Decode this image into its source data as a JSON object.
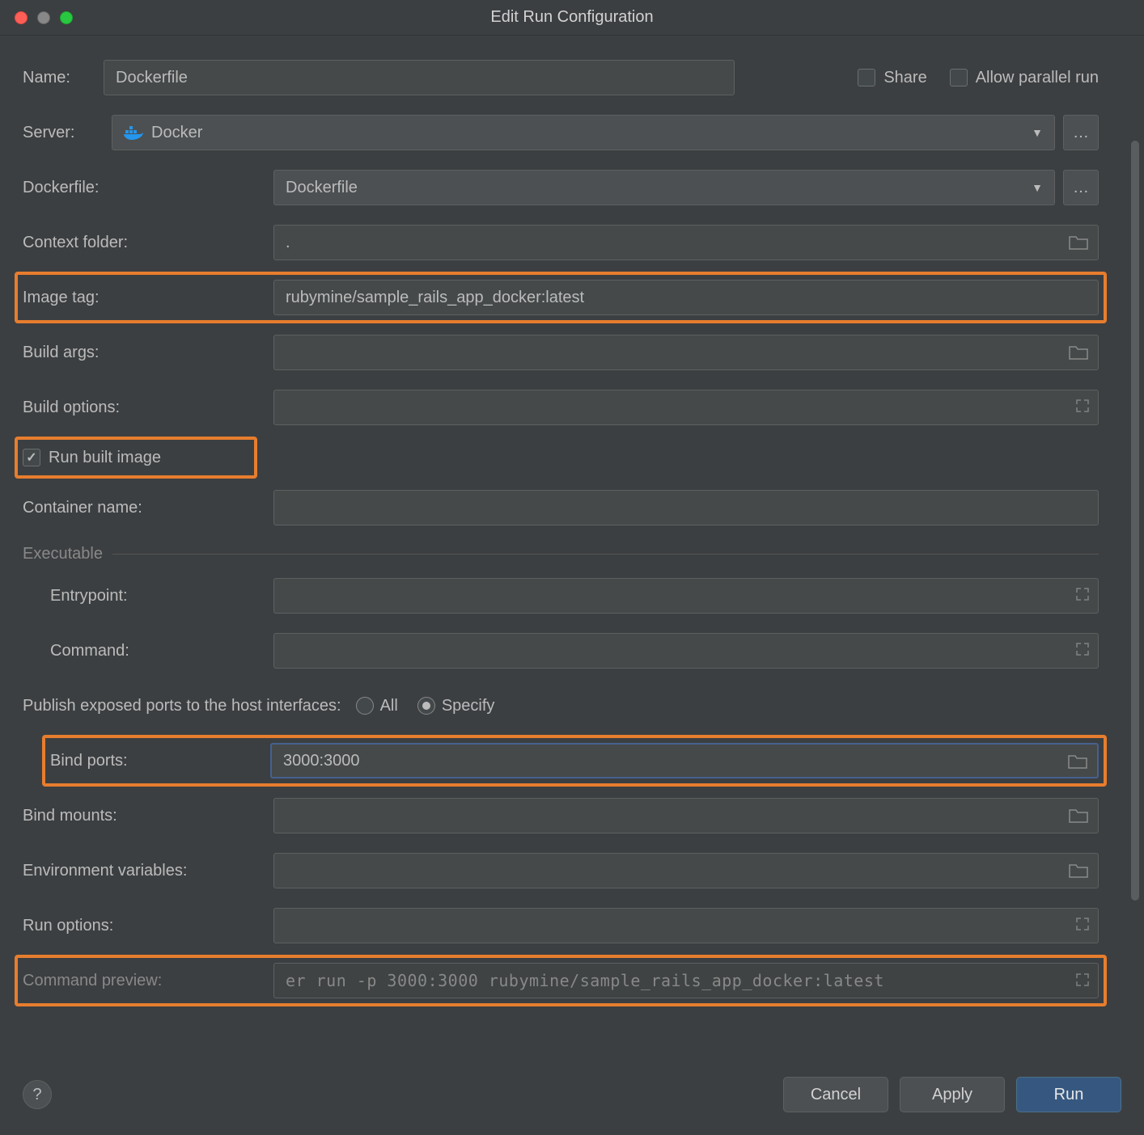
{
  "window": {
    "title": "Edit Run Configuration"
  },
  "name": {
    "label": "Name:",
    "value": "Dockerfile"
  },
  "share": {
    "label": "Share",
    "checked": false
  },
  "allowParallel": {
    "label": "Allow parallel run",
    "checked": false
  },
  "server": {
    "label": "Server:",
    "value": "Docker"
  },
  "dockerfile": {
    "label": "Dockerfile:",
    "value": "Dockerfile"
  },
  "contextFolder": {
    "label": "Context folder:",
    "value": "."
  },
  "imageTag": {
    "label": "Image tag:",
    "value": "rubymine/sample_rails_app_docker:latest"
  },
  "buildArgs": {
    "label": "Build args:",
    "value": ""
  },
  "buildOptions": {
    "label": "Build options:",
    "value": ""
  },
  "runBuiltImage": {
    "label": "Run built image",
    "checked": true
  },
  "containerName": {
    "label": "Container name:",
    "value": ""
  },
  "executable": {
    "label": "Executable"
  },
  "entrypoint": {
    "label": "Entrypoint:",
    "value": ""
  },
  "command": {
    "label": "Command:",
    "value": ""
  },
  "publishPorts": {
    "label": "Publish exposed ports to the host interfaces:",
    "all": "All",
    "specify": "Specify"
  },
  "bindPorts": {
    "label": "Bind ports:",
    "value": "3000:3000"
  },
  "bindMounts": {
    "label": "Bind mounts:",
    "value": ""
  },
  "envVars": {
    "label": "Environment variables:",
    "value": ""
  },
  "runOptions": {
    "label": "Run options:",
    "value": ""
  },
  "commandPreview": {
    "label": "Command preview:",
    "value": "er run -p 3000:3000  rubymine/sample_rails_app_docker:latest"
  },
  "buttons": {
    "cancel": "Cancel",
    "apply": "Apply",
    "run": "Run"
  }
}
